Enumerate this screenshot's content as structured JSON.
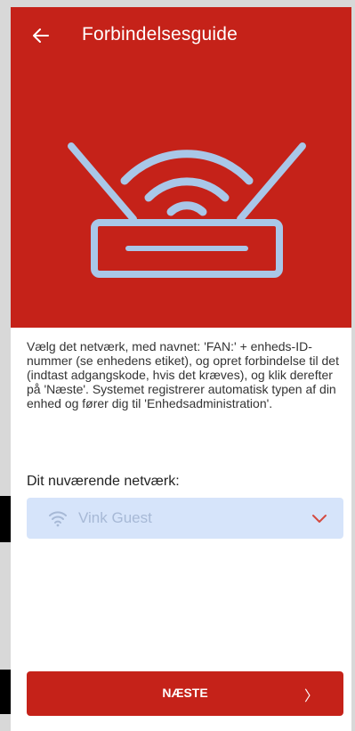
{
  "header": {
    "title": "Forbindelsesguide",
    "back_icon": "arrow-left-icon"
  },
  "hero": {
    "illustration": "router-wifi-illustration",
    "background_color": "#c52219",
    "illustration_color": "#a9c7e8"
  },
  "instructions": "Vælg det netværk, med navnet: 'FAN:' + enheds-ID-nummer (se enhedens etiket), og opret forbindelse til det (indtast adgangskode, hvis det kræves), og klik derefter på 'Næste'. Systemet registrerer automatisk typen af din enhed og fører dig til 'Enhedsadministration'.",
  "network": {
    "label": "Dit nuværende netværk:",
    "value": "Vink Guest",
    "icon": "wifi-icon",
    "dropdown_icon": "chevron-down-icon"
  },
  "footer": {
    "next_label": "NÆSTE",
    "next_arrow": "〉"
  }
}
